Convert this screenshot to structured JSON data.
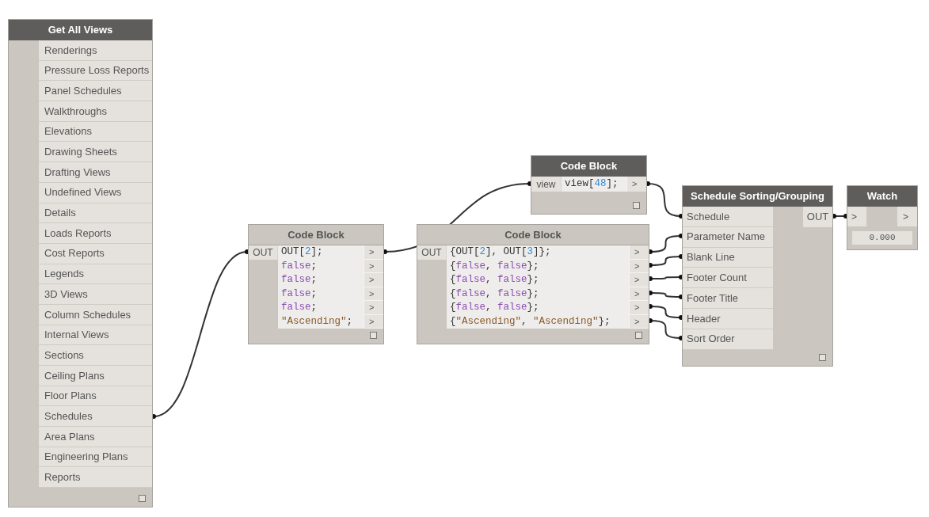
{
  "nodes": [
    {
      "kind": "list",
      "title": "Get All Views",
      "selected": true,
      "items": [
        "Renderings",
        "Pressure Loss Reports",
        "Panel Schedules",
        "Walkthroughs",
        "Elevations",
        "Drawing Sheets",
        "Drafting Views",
        "Undefined Views",
        "Details",
        "Loads Reports",
        "Cost Reports",
        "Legends",
        "3D Views",
        "Column Schedules",
        "Internal Views",
        "Sections",
        "Ceiling Plans",
        "Floor Plans",
        "Schedules",
        "Area Plans",
        "Engineering Plans",
        "Reports"
      ]
    },
    {
      "kind": "code",
      "title": "Code Block",
      "selected": true,
      "input": "view",
      "outputs": [
        ">"
      ],
      "lines": [
        [
          {
            "kind": "plain",
            "text": "view["
          },
          {
            "kind": "number",
            "text": "48"
          },
          {
            "kind": "plain",
            "text": "];"
          }
        ]
      ]
    },
    {
      "kind": "code",
      "title": "Code Block",
      "selected": false,
      "input": "OUT",
      "outputs": [
        ">",
        ">",
        ">",
        ">",
        ">",
        ">"
      ],
      "lines": [
        [
          {
            "kind": "plain",
            "text": "OUT["
          },
          {
            "kind": "number",
            "text": "2"
          },
          {
            "kind": "plain",
            "text": "];"
          }
        ],
        [
          {
            "kind": "keyword",
            "text": "false"
          },
          {
            "kind": "plain",
            "text": ";"
          }
        ],
        [
          {
            "kind": "keyword",
            "text": "false"
          },
          {
            "kind": "plain",
            "text": ";"
          }
        ],
        [
          {
            "kind": "keyword",
            "text": "false"
          },
          {
            "kind": "plain",
            "text": ";"
          }
        ],
        [
          {
            "kind": "keyword",
            "text": "false"
          },
          {
            "kind": "plain",
            "text": ";"
          }
        ],
        [
          {
            "kind": "string",
            "text": "\"Ascending\""
          },
          {
            "kind": "plain",
            "text": ";"
          }
        ]
      ]
    },
    {
      "kind": "code",
      "title": "Code Block",
      "selected": false,
      "input": "OUT",
      "outputs": [
        ">",
        ">",
        ">",
        ">",
        ">",
        ">"
      ],
      "lines": [
        [
          {
            "kind": "plain",
            "text": "{OUT["
          },
          {
            "kind": "number",
            "text": "2"
          },
          {
            "kind": "plain",
            "text": "], OUT["
          },
          {
            "kind": "number",
            "text": "3"
          },
          {
            "kind": "plain",
            "text": "]};"
          }
        ],
        [
          {
            "kind": "plain",
            "text": "{"
          },
          {
            "kind": "keyword",
            "text": "false"
          },
          {
            "kind": "plain",
            "text": ", "
          },
          {
            "kind": "keyword",
            "text": "false"
          },
          {
            "kind": "plain",
            "text": "};"
          }
        ],
        [
          {
            "kind": "plain",
            "text": "{"
          },
          {
            "kind": "keyword",
            "text": "false"
          },
          {
            "kind": "plain",
            "text": ", "
          },
          {
            "kind": "keyword",
            "text": "false"
          },
          {
            "kind": "plain",
            "text": "};"
          }
        ],
        [
          {
            "kind": "plain",
            "text": "{"
          },
          {
            "kind": "keyword",
            "text": "false"
          },
          {
            "kind": "plain",
            "text": ", "
          },
          {
            "kind": "keyword",
            "text": "false"
          },
          {
            "kind": "plain",
            "text": "};"
          }
        ],
        [
          {
            "kind": "plain",
            "text": "{"
          },
          {
            "kind": "keyword",
            "text": "false"
          },
          {
            "kind": "plain",
            "text": ", "
          },
          {
            "kind": "keyword",
            "text": "false"
          },
          {
            "kind": "plain",
            "text": "};"
          }
        ],
        [
          {
            "kind": "plain",
            "text": "{"
          },
          {
            "kind": "string",
            "text": "\"Ascending\""
          },
          {
            "kind": "plain",
            "text": ", "
          },
          {
            "kind": "string",
            "text": "\"Ascending\""
          },
          {
            "kind": "plain",
            "text": "};"
          }
        ]
      ]
    },
    {
      "kind": "function",
      "title": "Schedule Sorting/Grouping",
      "selected": true,
      "inputs": [
        "Schedule",
        "Parameter Name",
        "Blank Line",
        "Footer Count",
        "Footer Title",
        "Header",
        "Sort Order"
      ],
      "output": "OUT"
    },
    {
      "kind": "watch",
      "title": "Watch",
      "selected": true,
      "input": ">",
      "output": ">",
      "value": "0.000"
    }
  ]
}
